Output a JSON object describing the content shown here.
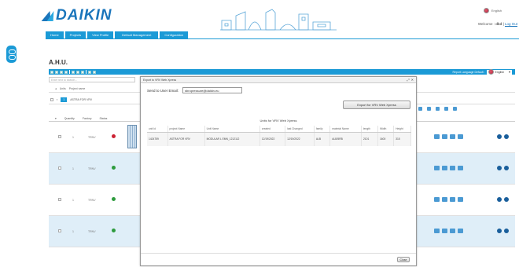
{
  "header": {
    "brand": "DAIKIN",
    "lang_top": "English",
    "welcome_prefix": "Welcome : ",
    "welcome_user": "dkd",
    "logout": "Log Out"
  },
  "nav": [
    {
      "label": "Home"
    },
    {
      "label": "Projects"
    },
    {
      "label": "View Profile"
    },
    {
      "label": "Default Management"
    },
    {
      "label": "Configuration"
    }
  ],
  "page": {
    "title": "A.H.U.",
    "report_lang_label": "Report Language Default :",
    "report_lang_value": "English"
  },
  "background": {
    "search_placeholder": "Enter text to search...",
    "units_label": "Units",
    "project_label": "Project name",
    "selected_count": "1",
    "project_code": "ASTRA FOR VRV",
    "headers": [
      "Quantity",
      "Factory",
      "Status"
    ],
    "rows": [
      {
        "qty": "1",
        "factory": "TRNV",
        "status": "red",
        "selected": false
      },
      {
        "qty": "1",
        "factory": "TRNV",
        "status": "green",
        "selected": true
      },
      {
        "qty": "1",
        "factory": "TRNV",
        "status": "green",
        "selected": false
      },
      {
        "qty": "1",
        "factory": "TRNV",
        "status": "green",
        "selected": true
      }
    ]
  },
  "modal": {
    "title": "Export to VRV Web Xpress",
    "send_label": "Send to User Email:",
    "email_value": "sbropressure@daikin.eu",
    "export_button": "Export for VRV Web Xpress",
    "units_title": "Units for VRV Web Xpress",
    "columns": [
      "unit Id",
      "project Name",
      "Unit Name",
      "created",
      "last Changed",
      "family",
      "material Name",
      "length",
      "Width",
      "Height"
    ],
    "rows": [
      [
        "1424759",
        "ASTRA FOR VRV",
        "MODULAR L EMN_1212112",
        "12/19/2022",
        "12/19/2022",
        "ALB",
        "ALB/5RB",
        "2101",
        "1600",
        "315"
      ]
    ],
    "close_button": "Close"
  }
}
